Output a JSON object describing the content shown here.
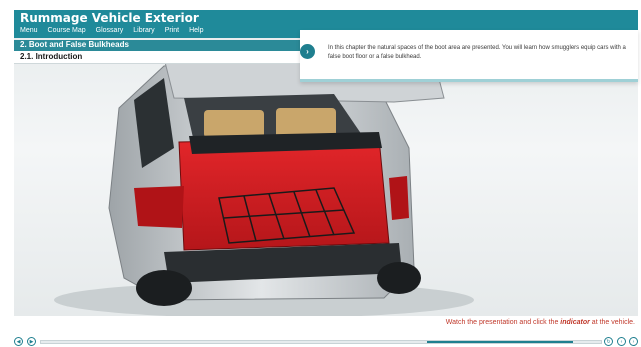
{
  "app": {
    "title": "Rummage Vehicle Exterior",
    "menu": [
      "Menu",
      "Course Map",
      "Glossary",
      "Library",
      "Print",
      "Help"
    ]
  },
  "chapter": {
    "title": "2. Boot and False Bulkheads",
    "section": "2.1. Introduction"
  },
  "info": {
    "text": "In this chapter the natural spaces of the boot area are presented. You will learn how smugglers equip cars with a false boot floor or a false bulkhead.",
    "next_icon": "chevron-right-icon"
  },
  "instruction": {
    "before": "Watch the presentation and click the ",
    "highlight": "indicator",
    "after": " at the vehicle."
  },
  "player": {
    "progress": 0.95,
    "icons": [
      "rewind-icon",
      "play-icon",
      "replay-icon",
      "back-icon",
      "forward-icon"
    ]
  },
  "colors": {
    "brand": "#1f8a9a",
    "accent": "#1f7f8f",
    "instruction": "#c0392b",
    "boot_interior": "#d61f24"
  }
}
